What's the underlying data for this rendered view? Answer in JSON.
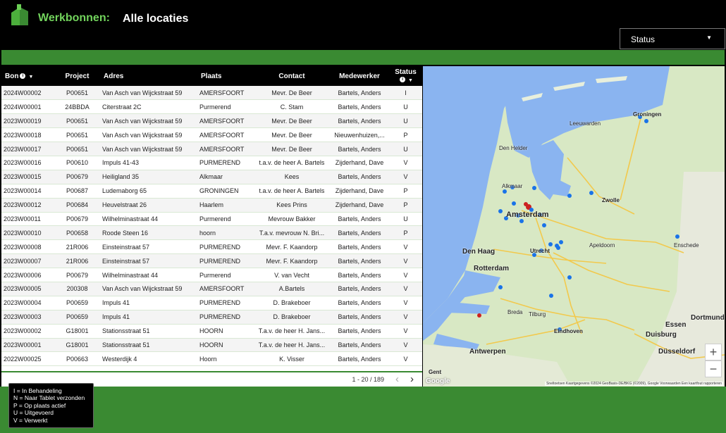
{
  "header": {
    "app_title": "Werkbonnen:",
    "page_title": "Alle locaties",
    "status_filter": "Status"
  },
  "table": {
    "columns": {
      "bon": "Bon",
      "project": "Project",
      "adres": "Adres",
      "plaats": "Plaats",
      "contact": "Contact",
      "medewerker": "Medewerker",
      "status": "Status"
    },
    "rows": [
      {
        "bon": "2024W00002",
        "project": "P00651",
        "adres": "Van Asch van Wijckstraat 59",
        "plaats": "AMERSFOORT",
        "contact": "Mevr. De Beer",
        "medewerker": "Bartels, Anders",
        "status": "I"
      },
      {
        "bon": "2024W00001",
        "project": "24BBDA",
        "adres": "Citerstraat 2C",
        "plaats": "Purmerend",
        "contact": "C. Stam",
        "medewerker": "Bartels, Anders",
        "status": "U"
      },
      {
        "bon": "2023W00019",
        "project": "P00651",
        "adres": "Van Asch van Wijckstraat 59",
        "plaats": "AMERSFOORT",
        "contact": "Mevr. De Beer",
        "medewerker": "Bartels, Anders",
        "status": "U"
      },
      {
        "bon": "2023W00018",
        "project": "P00651",
        "adres": "Van Asch van Wijckstraat 59",
        "plaats": "AMERSFOORT",
        "contact": "Mevr. De Beer",
        "medewerker": "Nieuwenhuizen,...",
        "status": "P"
      },
      {
        "bon": "2023W00017",
        "project": "P00651",
        "adres": "Van Asch van Wijckstraat 59",
        "plaats": "AMERSFOORT",
        "contact": "Mevr. De Beer",
        "medewerker": "Bartels, Anders",
        "status": "U"
      },
      {
        "bon": "2023W00016",
        "project": "P00610",
        "adres": "Impuls 41-43",
        "plaats": "PURMEREND",
        "contact": "t.a.v. de heer A. Bartels",
        "medewerker": "Zijderhand, Dave",
        "status": "V"
      },
      {
        "bon": "2023W00015",
        "project": "P00679",
        "adres": "Heiligland 35",
        "plaats": "Alkmaar",
        "contact": "Kees",
        "medewerker": "Bartels, Anders",
        "status": "V"
      },
      {
        "bon": "2023W00014",
        "project": "P00687",
        "adres": "Ludemaborg 65",
        "plaats": "GRONINGEN",
        "contact": "t.a.v. de heer A. Bartels",
        "medewerker": "Zijderhand, Dave",
        "status": "P"
      },
      {
        "bon": "2023W00012",
        "project": "P00684",
        "adres": "Heuvelstraat 26",
        "plaats": "Haarlem",
        "contact": "Kees Prins",
        "medewerker": "Zijderhand, Dave",
        "status": "P"
      },
      {
        "bon": "2023W00011",
        "project": "P00679",
        "adres": "Wilhelminastraat 44",
        "plaats": "Purmerend",
        "contact": "Mevrouw Bakker",
        "medewerker": "Bartels, Anders",
        "status": "U"
      },
      {
        "bon": "2023W00010",
        "project": "P00658",
        "adres": "Roode Steen 16",
        "plaats": "hoorn",
        "contact": "T.a.v. mevrouw N. Bri...",
        "medewerker": "Bartels, Anders",
        "status": "P"
      },
      {
        "bon": "2023W00008",
        "project": "21R006",
        "adres": "Einsteinstraat 57",
        "plaats": "PURMEREND",
        "contact": "Mevr. F. Kaandorp",
        "medewerker": "Bartels, Anders",
        "status": "V"
      },
      {
        "bon": "2023W00007",
        "project": "21R006",
        "adres": "Einsteinstraat 57",
        "plaats": "PURMEREND",
        "contact": "Mevr. F. Kaandorp",
        "medewerker": "Bartels, Anders",
        "status": "V"
      },
      {
        "bon": "2023W00006",
        "project": "P00679",
        "adres": "Wilhelminastraat 44",
        "plaats": "Purmerend",
        "contact": "V. van Vecht",
        "medewerker": "Bartels, Anders",
        "status": "V"
      },
      {
        "bon": "2023W00005",
        "project": "200308",
        "adres": "Van Asch van Wijckstraat 59",
        "plaats": "AMERSFOORT",
        "contact": "A.Bartels",
        "medewerker": "Bartels, Anders",
        "status": "V"
      },
      {
        "bon": "2023W00004",
        "project": "P00659",
        "adres": "Impuls 41",
        "plaats": "PURMEREND",
        "contact": "D. Brakeboer",
        "medewerker": "Bartels, Anders",
        "status": "V"
      },
      {
        "bon": "2023W00003",
        "project": "P00659",
        "adres": "Impuls 41",
        "plaats": "PURMEREND",
        "contact": "D. Brakeboer",
        "medewerker": "Bartels, Anders",
        "status": "V"
      },
      {
        "bon": "2023W00002",
        "project": "G18001",
        "adres": "Stationsstraat 51",
        "plaats": "HOORN",
        "contact": "T.a.v. de heer H. Jans...",
        "medewerker": "Bartels, Anders",
        "status": "V"
      },
      {
        "bon": "2023W00001",
        "project": "G18001",
        "adres": "Stationsstraat 51",
        "plaats": "HOORN",
        "contact": "T.a.v. de heer H. Jans...",
        "medewerker": "Bartels, Anders",
        "status": "V"
      },
      {
        "bon": "2022W00025",
        "project": "P00663",
        "adres": "Westerdijk 4",
        "plaats": "Hoorn",
        "contact": "K. Visser",
        "medewerker": "Bartels, Anders",
        "status": "V"
      }
    ],
    "pagination": "1 - 20 / 189"
  },
  "map": {
    "labels": {
      "amsterdam": "Amsterdam",
      "den_haag": "Den Haag",
      "rotterdam": "Rotterdam",
      "utrecht": "Utrecht",
      "groningen": "Groningen",
      "zwolle": "Zwolle",
      "antwerpen": "Antwerpen",
      "eindhoven": "Eindhoven",
      "dusseldorf": "Düsseldorf",
      "essen": "Essen",
      "dortmund": "Dortmund",
      "duisburg": "Duisburg",
      "gent": "Gent",
      "alkmaar": "Alkmaar",
      "apeldoorn": "Apeldoorn",
      "enschede": "Enschede",
      "tilburg": "Tilburg",
      "breda": "Breda",
      "leeuwarden": "Leeuwarden",
      "den_helder": "Den Helder"
    },
    "zoom_in": "+",
    "zoom_out": "−",
    "google": "Google",
    "attribution": "Sneltoetsen  Kaartgegevens ©2024 GeoBasis-DE/BKG (©2009), Google  Voorwaarden  Een kaartfout rapporteren"
  },
  "legend": {
    "items": [
      "I  = In Behandeling",
      "N = Naar Tablet verzonden",
      "P = Op plaats actief",
      "U = Uitgevoerd",
      "V = Verwerkt"
    ]
  }
}
